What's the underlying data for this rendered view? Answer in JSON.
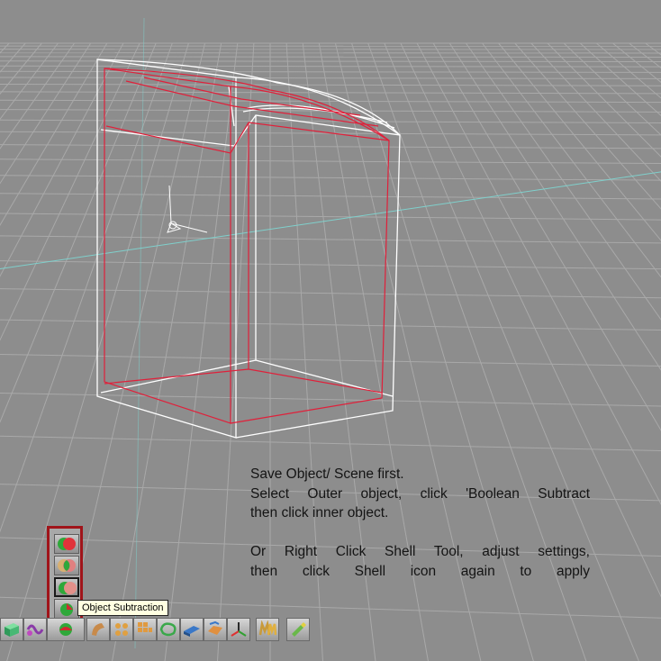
{
  "viewport": {
    "background": "#8d8d8d",
    "grid_color": "#aaaaaa",
    "axis_color": "#7fd0cc",
    "outer_object_color": "#ffffff",
    "inner_object_color": "#e0203a"
  },
  "instructions": {
    "line1": "Save Object/ Scene first.",
    "line2": "Select Outer object, click 'Boolean Subtract",
    "line3": "then click inner object.",
    "line4": "Or Right Click Shell Tool, adjust settings,",
    "line5": "then click Shell icon again to apply"
  },
  "boolean_flyout": {
    "border_color": "#a0141a",
    "tools": [
      {
        "icon": "boolean-union-icon"
      },
      {
        "icon": "boolean-intersect-icon"
      },
      {
        "icon": "boolean-split-icon"
      },
      {
        "icon": "object-subtraction-icon"
      },
      {
        "icon": "boolean-subtract-icon"
      }
    ]
  },
  "tooltip": {
    "text": "Object Subtraction"
  },
  "toolbar": {
    "tools": [
      {
        "icon": "cube-primitive-icon"
      },
      {
        "icon": "twist-deform-icon"
      },
      {
        "icon": "boolean-tools-icon"
      },
      {
        "icon": "sweep-icon"
      },
      {
        "icon": "lathe-icon"
      },
      {
        "icon": "grid-array-icon"
      },
      {
        "icon": "loft-icon"
      },
      {
        "icon": "extrude-icon"
      },
      {
        "icon": "bevel-icon"
      },
      {
        "icon": "axis-transform-icon"
      },
      {
        "icon": "magnet-modeling-icon"
      },
      {
        "icon": "paint-tool-icon"
      }
    ]
  }
}
